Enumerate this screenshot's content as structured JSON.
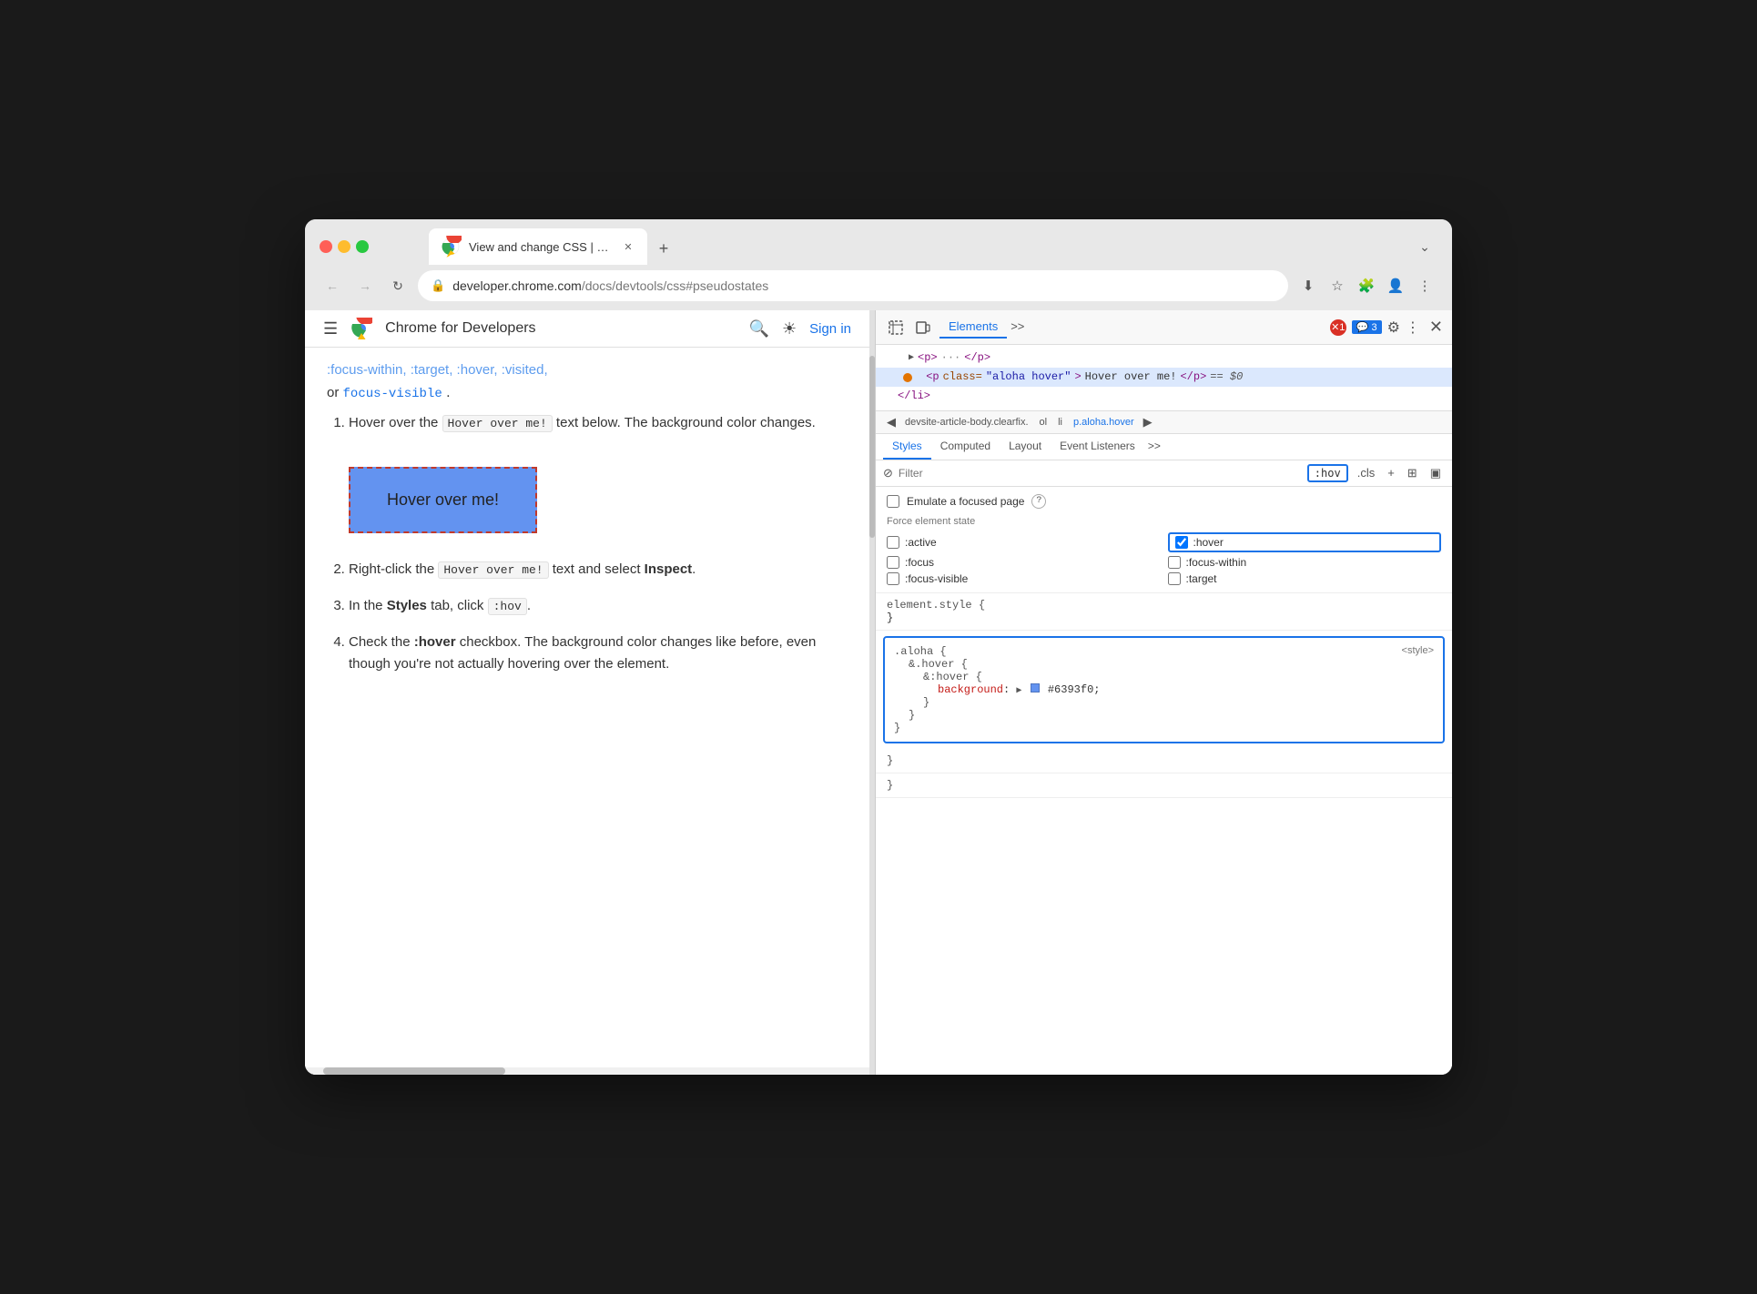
{
  "browser": {
    "tab_title": "View and change CSS | Chr…",
    "tab_url_display": "View and change CSS | Chr…",
    "new_tab_label": "+",
    "dropdown_label": "⌄",
    "url": {
      "full": "developer.chrome.com/docs/devtools/css#pseudostates",
      "domain": "developer.chrome.com",
      "path": "/docs/devtools/css#pseudostates"
    },
    "back_btn": "←",
    "forward_btn": "→",
    "reload_btn": "↻"
  },
  "site_header": {
    "hamburger": "☰",
    "site_name": "Chrome for Developers",
    "search_label": "🔍",
    "theme_label": "☀",
    "sign_in": "Sign in"
  },
  "page_content": {
    "faded_links": ":focus-within, :target, :hover, :visited,",
    "focus_visible": "focus-visible",
    "period": ".",
    "steps": [
      {
        "num": 1,
        "text_before": "Hover over the ",
        "code": "Hover over me!",
        "text_after": " text below. The background color changes."
      },
      {
        "num": 2,
        "text_before": "Right-click the ",
        "code": "Hover over me!",
        "text_after": " text and select ",
        "bold": "Inspect",
        "bold_suffix": "."
      },
      {
        "num": 3,
        "text_before": "In the ",
        "bold": "Styles",
        "text_after": " tab, click ",
        "code": ":hov",
        "suffix": "."
      },
      {
        "num": 4,
        "text_before": "Check the ",
        "bold": ":hover",
        "text_after": " checkbox. The background color changes like before, even though you're not actually hovering over the element."
      }
    ],
    "hover_box_text": "Hover over me!"
  },
  "devtools": {
    "toolbar": {
      "elements_tab": "Elements",
      "more_tabs": ">>",
      "error_count": "1",
      "warning_count": "3",
      "settings_icon": "⚙",
      "more_icon": "⋮",
      "close_icon": "✕"
    },
    "dom": {
      "rows": [
        {
          "content": "▶ <p> ··· </p>",
          "indent": 20
        },
        {
          "content": "<p class=\"aloha hover\">Hover over me!</p> == $0",
          "indent": 30,
          "selected": true,
          "has_dot": true
        },
        {
          "content": "</li>",
          "indent": 24
        }
      ]
    },
    "breadcrumb": {
      "left_arrow": "◀",
      "items": [
        "devsite-article-body.clearfix.",
        "ol",
        "li",
        "p.aloha.hover"
      ],
      "right_arrow": "▶"
    },
    "styles_tabs": {
      "tabs": [
        "Styles",
        "Computed",
        "Layout",
        "Event Listeners"
      ],
      "more": ">>",
      "active": "Styles"
    },
    "filter": {
      "icon": "⊘",
      "placeholder": "Filter",
      "hov_badge": ":hov",
      "cls_btn": ".cls",
      "plus_btn": "+",
      "layout_btn": "⊞",
      "sidebar_btn": "▣"
    },
    "pseudo_states": {
      "emulate_label": "Emulate a focused page",
      "force_state_label": "Force element state",
      "states": [
        {
          "id": "active",
          "label": ":active",
          "checked": false,
          "col": 0
        },
        {
          "id": "hover",
          "label": ":hover",
          "checked": true,
          "col": 1
        },
        {
          "id": "focus",
          "label": ":focus",
          "checked": false,
          "col": 0
        },
        {
          "id": "focus-within",
          "label": ":focus-within",
          "checked": false,
          "col": 1
        },
        {
          "id": "focus-visible",
          "label": ":focus-visible",
          "checked": false,
          "col": 0
        },
        {
          "id": "target",
          "label": ":target",
          "checked": false,
          "col": 1
        }
      ]
    },
    "css_rules": {
      "element_style": {
        "selector": "element.style {",
        "close": "}"
      },
      "aloha_rule": {
        "selector": ".aloha {",
        "nested1_selector": "&.hover {",
        "nested2_selector": "&:hover {",
        "property": "background",
        "colon": ":",
        "value": "#6393f0",
        "close_nested2": "}",
        "close_nested1": "}",
        "close": "}",
        "source": "<style>"
      },
      "extra_close1": "}",
      "extra_close2": "}"
    }
  },
  "colors": {
    "accent_blue": "#1a73e8",
    "hover_box_bg": "#6393f0",
    "hover_box_border": "#c0392b",
    "selected_dom": "#dbe8fd",
    "orange_dot": "#e37400"
  }
}
